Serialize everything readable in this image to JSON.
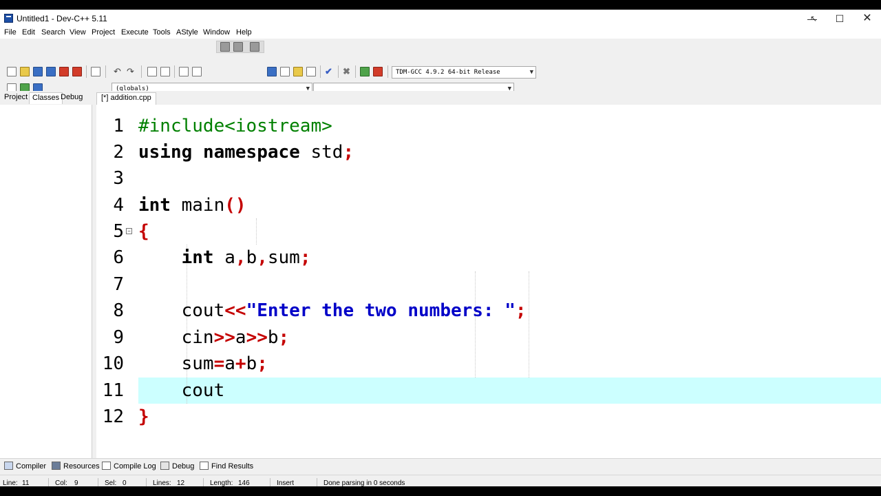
{
  "window": {
    "title": "Untitled1 - Dev-C++ 5.11",
    "minimize_glyph": "—",
    "maximize_glyph": "☐",
    "close_glyph": "✕"
  },
  "menu": [
    "File",
    "Edit",
    "Search",
    "View",
    "Project",
    "Execute",
    "Tools",
    "AStyle",
    "Window",
    "Help"
  ],
  "toolbar": {
    "compiler_select": "TDM-GCC 4.9.2 64-bit Release",
    "scope_select": "(globals)",
    "function_select": ""
  },
  "side_tabs": [
    "Project",
    "Classes",
    "Debug"
  ],
  "side_active": "Classes",
  "editor_tab": "[*] addition.cpp",
  "line_numbers": [
    "1",
    "2",
    "3",
    "4",
    "5",
    "6",
    "7",
    "8",
    "9",
    "10",
    "11",
    "12"
  ],
  "code": {
    "l1": {
      "pre": "#include<iostream>"
    },
    "l2": {
      "kw1": "using",
      "kw2": "namespace",
      "id": "std",
      "semi": ";"
    },
    "l4": {
      "kw": "int",
      "id": "main",
      "parens": "()"
    },
    "l5": {
      "brace": "{"
    },
    "l6": {
      "kw": "int",
      "a": "a",
      "c1": ",",
      "b": "b",
      "c2": ",",
      "sum": "sum",
      "semi": ";"
    },
    "l8": {
      "id": "cout",
      "op": "<<",
      "str": "\"Enter the two numbers: \"",
      "semi": ";"
    },
    "l9": {
      "id": "cin",
      "op1": ">>",
      "a": "a",
      "op2": ">>",
      "b": "b",
      "semi": ";"
    },
    "l10": {
      "id": "sum",
      "eq": "=",
      "a": "a",
      "plus": "+",
      "b": "b",
      "semi": ";"
    },
    "l11": {
      "id": "cout"
    },
    "l12": {
      "brace": "}"
    }
  },
  "current_line": 11,
  "bottom_tabs": [
    "Compiler",
    "Resources",
    "Compile Log",
    "Debug",
    "Find Results"
  ],
  "status": {
    "line": "Line:",
    "line_val": "11",
    "col": "Col:",
    "col_val": "9",
    "sel": "Sel:",
    "sel_val": "0",
    "lines": "Lines:",
    "lines_val": "12",
    "length": "Length:",
    "length_val": "146",
    "mode": "Insert",
    "message": "Done parsing in 0 seconds"
  },
  "colors": {
    "preprocessor": "#008000",
    "symbol": "#c40000",
    "string": "#0000c8",
    "current_line": "#ccffff"
  }
}
